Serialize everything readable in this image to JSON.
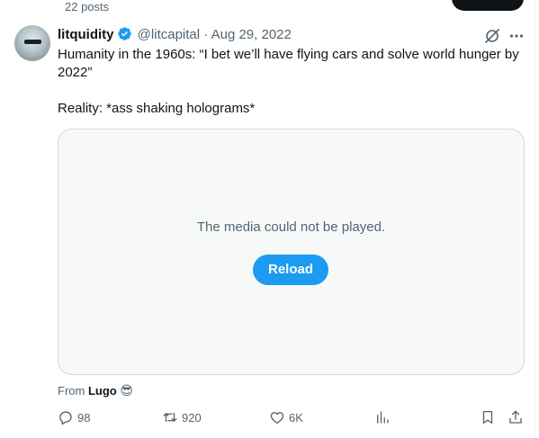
{
  "header_bar": {
    "posts_count": "22 posts"
  },
  "tweet": {
    "display_name": "litquidity",
    "handle": "@litcapital",
    "separator": "·",
    "date": "Aug 29, 2022",
    "text_line1": "Humanity in the 1960s: “I bet we’ll have flying cars and solve world hunger by 2022”",
    "text_line2": "Reality: *ass shaking holograms*",
    "media_error": "The media could not be played.",
    "reload_label": "Reload",
    "from_label": "From",
    "from_source": "Lugo",
    "from_emoji": "😎",
    "replies": "98",
    "reposts": "920",
    "likes": "6K"
  },
  "colors": {
    "accent": "#1d9bf0",
    "text_primary": "#0f1419",
    "text_secondary": "#536471",
    "border": "#cfd9de"
  },
  "icons": [
    "verified-badge-icon",
    "grok-icon",
    "more-icon",
    "reply-icon",
    "repost-icon",
    "like-icon",
    "views-icon",
    "bookmark-icon",
    "share-icon"
  ]
}
